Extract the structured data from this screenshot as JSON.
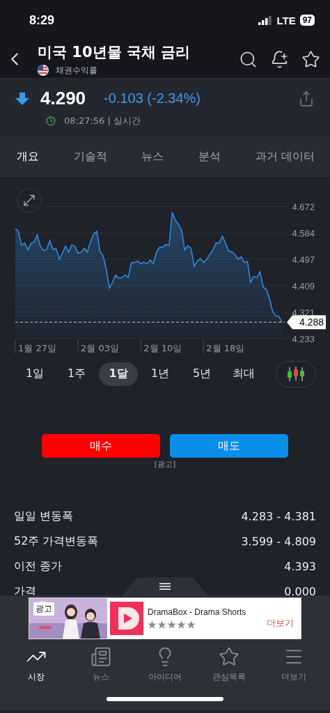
{
  "status_bar": {
    "time": "8:29",
    "network": "LTE",
    "battery": "97"
  },
  "header": {
    "title": "미국 10년물 국채 금리",
    "subtitle": "채권수익률"
  },
  "quote": {
    "price": "4.290",
    "change": "-0.103 (-2.34%)",
    "time": "08:27:56 | 실시간"
  },
  "tabs": [
    {
      "label": "개요",
      "selected": true
    },
    {
      "label": "기술적",
      "selected": false
    },
    {
      "label": "뉴스",
      "selected": false
    },
    {
      "label": "분석",
      "selected": false
    },
    {
      "label": "과거 데이터",
      "selected": false
    }
  ],
  "chart": {
    "x_labels": [
      "1월 27일",
      "2월 03일",
      "2월 10일",
      "2월 18일"
    ],
    "chart_data": {
      "type": "area",
      "grid": true,
      "series": [
        {
          "color": "#2f8ae0",
          "values": [
            4.599,
            4.59,
            4.544,
            4.551,
            4.528,
            4.55,
            4.555,
            4.578,
            4.54,
            4.526,
            4.53,
            4.559,
            4.53,
            4.532,
            4.497,
            4.517,
            4.54,
            4.521,
            4.545,
            4.54,
            4.517,
            4.521,
            4.534,
            4.521,
            4.555,
            4.582,
            4.59,
            4.522,
            4.509,
            4.463,
            4.401,
            4.421,
            4.444,
            4.434,
            4.436,
            4.445,
            4.436,
            4.486,
            4.486,
            4.491,
            4.482,
            4.488,
            4.482,
            4.494,
            4.482,
            4.521,
            4.537,
            4.537,
            4.547,
            4.542,
            4.653,
            4.628,
            4.613,
            4.594,
            4.528,
            4.542,
            4.534,
            4.474,
            4.49,
            4.499,
            4.486,
            4.497,
            4.513,
            4.528,
            4.551,
            4.551,
            4.574,
            4.551,
            4.524,
            4.522,
            4.513,
            4.497,
            4.505,
            4.486,
            4.49,
            4.421,
            4.44,
            4.436,
            4.455,
            4.405,
            4.397,
            4.367,
            4.324,
            4.309,
            4.307,
            4.287
          ]
        }
      ],
      "ylim": [
        4.233,
        4.672
      ],
      "yticks": [
        4.233,
        4.321,
        4.409,
        4.497,
        4.584,
        4.672
      ],
      "ref_lines": [
        {
          "axis": "y",
          "value": 4.288,
          "label": "4.288"
        }
      ]
    }
  },
  "ranges": [
    {
      "label": "1일",
      "selected": false
    },
    {
      "label": "1주",
      "selected": false
    },
    {
      "label": "1달",
      "selected": true
    },
    {
      "label": "1년",
      "selected": false
    },
    {
      "label": "5년",
      "selected": false
    },
    {
      "label": "최대",
      "selected": false
    }
  ],
  "actions": [
    {
      "label": "매수",
      "kind": "buy"
    },
    {
      "label": "매도",
      "kind": "sell"
    }
  ],
  "ad_label": "[광고]",
  "stats": [
    {
      "label": "일일 변동폭",
      "value": "4.283 - 4.381"
    },
    {
      "label": "52주 가격변동폭",
      "value": "3.599 - 4.809"
    },
    {
      "label": "이전 종가",
      "value": "4.393"
    },
    {
      "label": "가격",
      "value": "0.000"
    }
  ],
  "ad": {
    "badge": "광고",
    "title": "DramaBox - Drama Shorts",
    "more": "더보기"
  },
  "nav": [
    {
      "label": "시장",
      "selected": true,
      "kind": "market"
    },
    {
      "label": "뉴스",
      "selected": false,
      "kind": "news"
    },
    {
      "label": "아이디어",
      "selected": false,
      "kind": "ideas"
    },
    {
      "label": "관심목록",
      "selected": false,
      "kind": "watchlist"
    },
    {
      "label": "더보기",
      "selected": false,
      "kind": "more"
    }
  ]
}
